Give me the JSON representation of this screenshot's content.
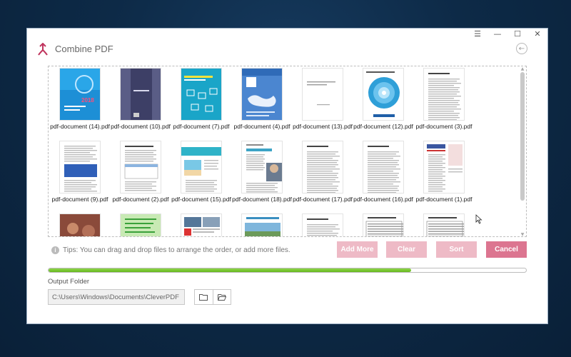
{
  "window": {
    "title": "Combine PDF",
    "controls": {
      "menu": "☰",
      "minimize": "—",
      "maximize": "☐",
      "close": "✕"
    },
    "back_icon": "←"
  },
  "files": [
    {
      "name": "pdf-document (14).pdf",
      "style": "blue-report"
    },
    {
      "name": "pdf-document (10).pdf",
      "style": "navy"
    },
    {
      "name": "pdf-document (7).pdf",
      "style": "teal-grid"
    },
    {
      "name": "pdf-document (4).pdf",
      "style": "blue-map"
    },
    {
      "name": "pdf-document (13).pdf",
      "style": "plain"
    },
    {
      "name": "pdf-document (12).pdf",
      "style": "swirl"
    },
    {
      "name": "pdf-document (3).pdf",
      "style": "text"
    },
    {
      "name": "pdf-document (9).pdf",
      "style": "text-blue"
    },
    {
      "name": "pdf-document (2).pdf",
      "style": "text-table"
    },
    {
      "name": "pdf-document (15).pdf",
      "style": "travel"
    },
    {
      "name": "pdf-document (18).pdf",
      "style": "photo-text"
    },
    {
      "name": "pdf-document (17).pdf",
      "style": "text"
    },
    {
      "name": "pdf-document (16).pdf",
      "style": "text"
    },
    {
      "name": "pdf-document (1).pdf",
      "style": "who"
    },
    {
      "name": "",
      "style": "photo-red"
    },
    {
      "name": "",
      "style": "green-quote"
    },
    {
      "name": "",
      "style": "photo-grid"
    },
    {
      "name": "",
      "style": "landscape"
    },
    {
      "name": "",
      "style": "text"
    },
    {
      "name": "",
      "style": "table"
    },
    {
      "name": "",
      "style": "table"
    }
  ],
  "tips": "Tips: You can drag and drop files to arrange the order, or add more files.",
  "buttons": {
    "add_more": "Add More",
    "clear": "Clear",
    "sort": "Sort",
    "cancel": "Cancel"
  },
  "progress": 0.76,
  "output": {
    "label": "Output Folder",
    "path": "C:\\Users\\Windows\\Documents\\CleverPDF"
  },
  "colors": {
    "accent": "#dc7590",
    "accent_light": "#eebac6",
    "progress": "#7cc537",
    "logo": "#c0355e"
  }
}
